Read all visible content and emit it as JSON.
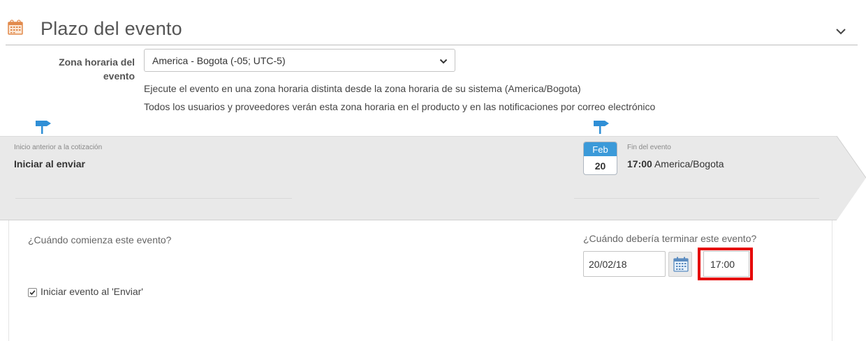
{
  "header": {
    "title": "Plazo del evento",
    "icon": "calendar-icon"
  },
  "timezone": {
    "label": "Zona horaria del evento",
    "selected": "America - Bogota (-05; UTC-5)",
    "help_line1": "Ejecute el evento en una zona horaria distinta desde la zona horaria de su sistema (America/Bogota)",
    "help_line2": "Todos los usuarios y proveedores verán esta zona horaria en el producto y en las notificaciones por correo electrónico"
  },
  "timeline": {
    "start_caption": "Inicio anterior a la cotización",
    "start_value": "Iniciar al enviar",
    "end_caption": "Fin del evento",
    "end_time": "17:00",
    "end_timezone": "America/Bogota",
    "calendar_month": "Feb",
    "calendar_day": "20"
  },
  "form": {
    "start_question": "¿Cuándo comienza este evento?",
    "end_question": "¿Cuándo debería terminar este evento?",
    "start_on_send_label": "Iniciar evento al 'Enviar'",
    "start_on_send_checked": true,
    "end_date": "20/02/18",
    "end_time": "17:00"
  },
  "colors": {
    "accent": "#3b9ad9",
    "highlight": "#e50000",
    "band": "#e9e9e9"
  }
}
